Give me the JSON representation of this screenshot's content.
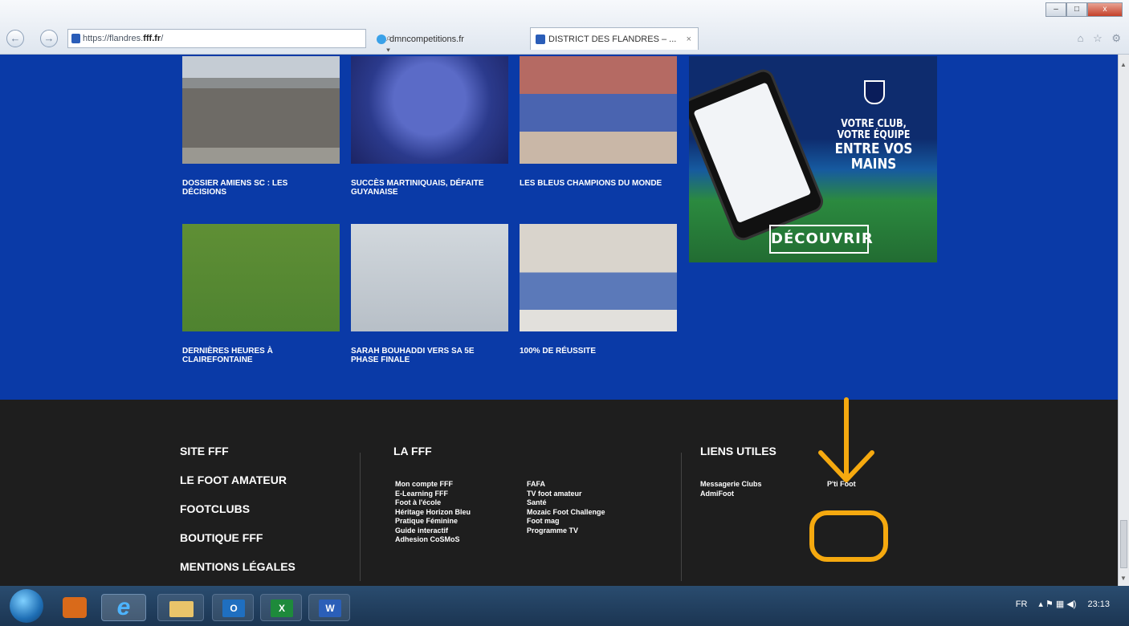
{
  "browser": {
    "url_prefix": "https://flandres.",
    "url_domain": "fff.fr",
    "url_suffix": "/",
    "address_tools": "⌕ ▾ ↻",
    "tabs": [
      {
        "label": "dmncompetitions.fr",
        "active": false
      },
      {
        "label": "DISTRICT DES FLANDRES – ...",
        "active": true
      }
    ],
    "close_glyph": "×",
    "back_glyph": "←",
    "forward_glyph": "→",
    "right_icons": "⌂ ☆ ⚙",
    "minimize_glyph": "–",
    "maximize_glyph": "□",
    "window_close_glyph": "x"
  },
  "articles": [
    {
      "title": "DOSSIER AMIENS SC : LES DÉCISIONS"
    },
    {
      "title": "SUCCÈS MARTINIQUAIS, DÉFAITE GUYANAISE"
    },
    {
      "title": "LES BLEUS CHAMPIONS DU MONDE"
    },
    {
      "title": "DERNIÈRES HEURES À CLAIREFONTAINE"
    },
    {
      "title": "SARAH BOUHADDI VERS SA 5E PHASE FINALE"
    },
    {
      "title": "100% DE RÉUSSITE"
    }
  ],
  "promo": {
    "line1": "VOTRE CLUB, VOTRE ÉQUIPE",
    "line2": "ENTRE VOS MAINS",
    "button": "DÉCOUVRIR"
  },
  "footer": {
    "main_links": [
      "SITE FFF",
      "LE FOOT AMATEUR",
      "FOOTCLUBS",
      "BOUTIQUE FFF",
      "MENTIONS LÉGALES"
    ],
    "la_fff": {
      "title": "LA FFF",
      "col1": [
        "Mon compte FFF",
        "E-Learning FFF",
        "Foot à l'école",
        "Héritage Horizon Bleu",
        "Pratique Féminine",
        "Guide interactif",
        "Adhesion CoSMoS"
      ],
      "col2": [
        "FAFA",
        "TV foot amateur",
        "Santé",
        "Mozaic Foot Challenge",
        "Foot mag",
        "Programme TV"
      ]
    },
    "liens_utiles": {
      "title": "LIENS UTILES",
      "col1": [
        "Messagerie Clubs",
        "AdmiFoot"
      ],
      "col2": [
        "P'ti Foot"
      ]
    }
  },
  "annotation": {
    "color": "#f5a90f"
  },
  "taskbar": {
    "apps": [
      "media-player",
      "internet-explorer",
      "file-explorer",
      "outlook",
      "excel",
      "word"
    ],
    "ie_glyph": "e",
    "outlook_glyph": "O",
    "excel_glyph": "X",
    "word_glyph": "W",
    "language": "FR",
    "tray_icons": "▴ ⚑ ▦ ◀)",
    "clock": "23:13"
  }
}
